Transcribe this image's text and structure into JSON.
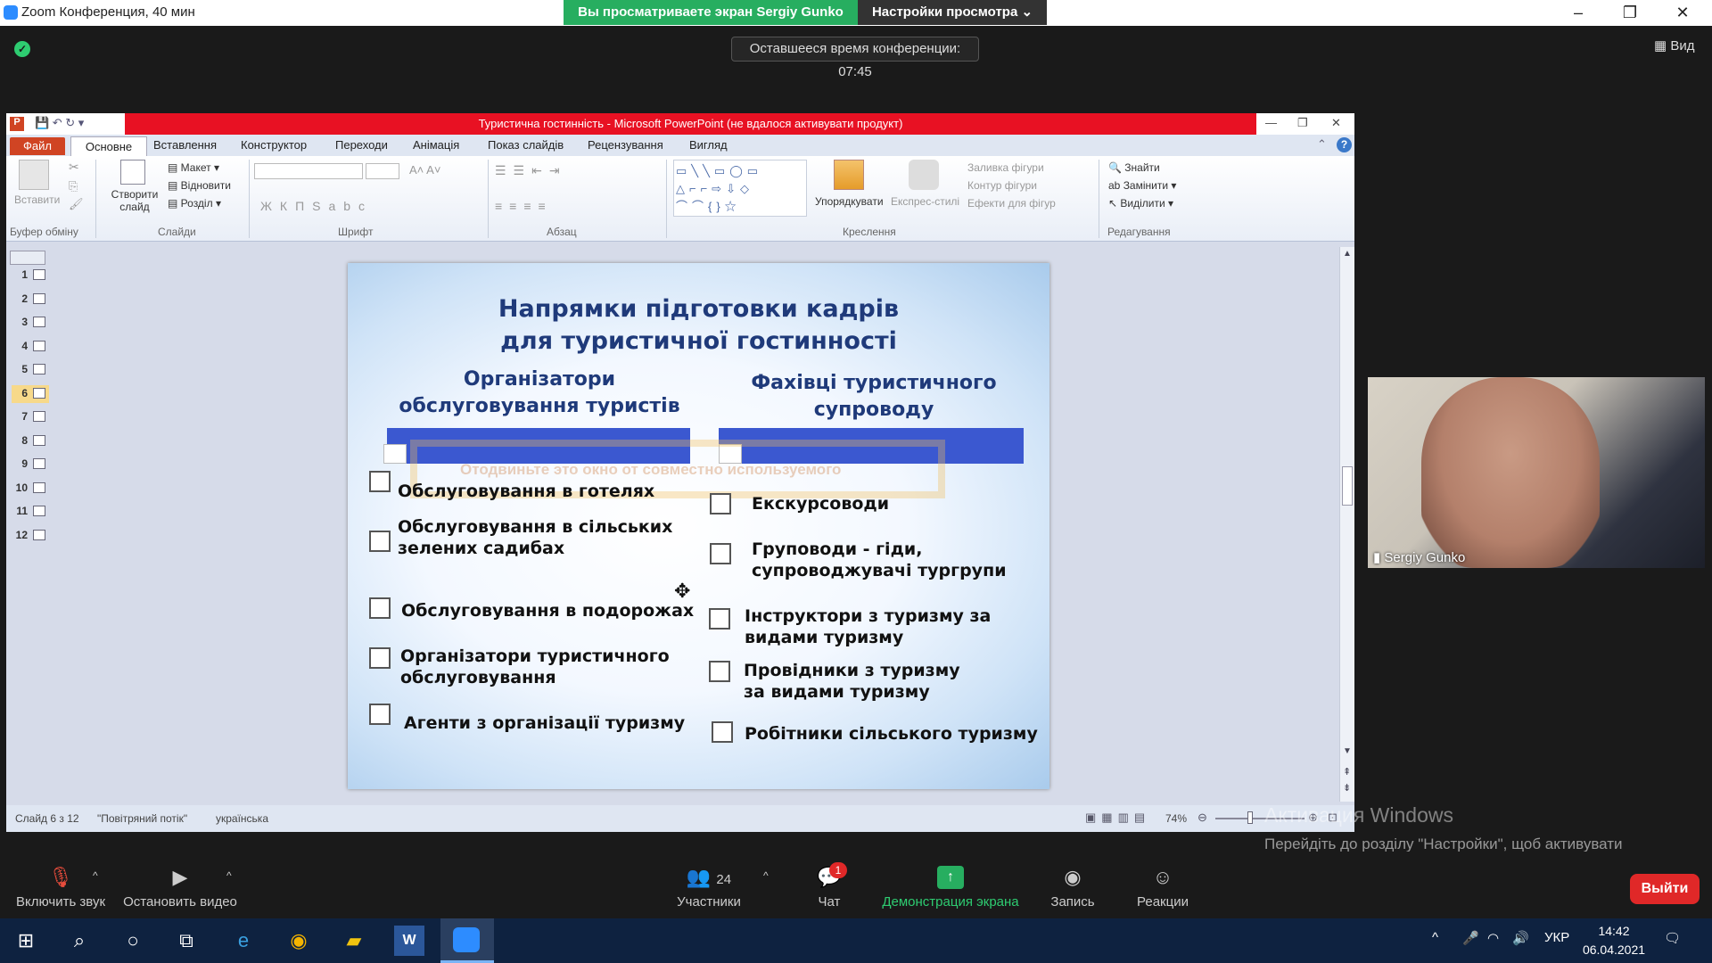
{
  "zoom": {
    "window_title": "Zoom Конференция, 40 мин",
    "share_banner": "Вы просматриваете экран Sergiy Gunko",
    "view_options": "Настройки просмотра ⌄",
    "remaining_time": "Оставшееся время конференции: 07:45",
    "view_button": "Вид",
    "participant_name": "Sergiy Gunko",
    "toolbar": {
      "mute": "Включить звук",
      "video": "Остановить видео",
      "participants": "Участники",
      "participants_count": "24",
      "chat": "Чат",
      "chat_badge": "1",
      "share": "Демонстрация экрана",
      "record": "Запись",
      "reactions": "Реакции",
      "leave": "Выйти"
    },
    "accent_green": "#27ae60",
    "leave_red": "#e02828"
  },
  "windows": {
    "activate_title": "Активация Windows",
    "activate_text": "Перейдіть до розділу \"Настройки\", щоб активувати Windows.",
    "time": "14:42",
    "date": "06.04.2021",
    "lang": "УКР"
  },
  "powerpoint": {
    "title": "Туристична гостинність - Microsoft PowerPoint (не вдалося активувати продукт)",
    "tabs": [
      "Файл",
      "Основне",
      "Вставлення",
      "Конструктор",
      "Переходи",
      "Анімація",
      "Показ слайдів",
      "Рецензування",
      "Вигляд"
    ],
    "ribbon": {
      "paste": "Вставити",
      "clipboard_group": "Буфер обміну",
      "new_slide": "Створити слайд",
      "layout": "Макет",
      "reset": "Відновити",
      "section": "Розділ",
      "slides_group": "Слайди",
      "font_group": "Шрифт",
      "paragraph_group": "Абзац",
      "arrange": "Упорядкувати",
      "quick_styles": "Експрес-стилі",
      "shape_fill": "Заливка фігури",
      "shape_outline": "Контур фігури",
      "shape_effects": "Ефекти для фігур",
      "drawing_group": "Креслення",
      "find": "Знайти",
      "replace": "Замінити",
      "select": "Виділити",
      "editing_group": "Редагування"
    },
    "slide_numbers": [
      "1",
      "2",
      "3",
      "4",
      "5",
      "6",
      "7",
      "8",
      "9",
      "10",
      "11",
      "12"
    ],
    "status": {
      "slide": "Слайд 6 з 12",
      "theme": "\"Повітряний потік\"",
      "language": "українська",
      "zoom": "74%"
    }
  },
  "slide": {
    "title_line1": "Напрямки підготовки кадрів",
    "title_line2": "для туристичної гостинності",
    "left_header_line1": "Організатори",
    "left_header_line2": "обслуговування туристів",
    "right_header_line1": "Фахівці туристичного",
    "right_header_line2": "супроводу",
    "overlay_watermark": "Отодвиньте это окно от совместно используемого",
    "left_items": [
      "Обслуговування в готелях",
      "Обслуговування в сільських зелених садибах",
      "Обслуговування в подорожах",
      "Організатори туристичного обслуговування",
      "Агенти з організації туризму"
    ],
    "right_items": [
      "Екскурсоводи",
      "Груповоди - гіди, супроводжувачі тургрупи",
      "Інструктори з туризму за видами туризму",
      "Провідники з туризму за видами туризму",
      "Робітники сільського туризму"
    ]
  }
}
